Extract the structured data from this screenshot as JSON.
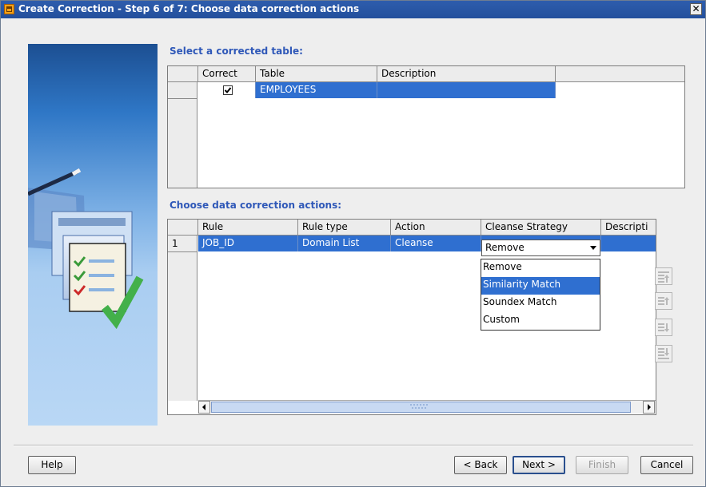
{
  "window": {
    "title": "Create Correction - Step 6 of 7: Choose data correction actions",
    "close_glyph": "✕"
  },
  "table1": {
    "label": "Select a corrected table:",
    "columns": [
      "Correct",
      "Table",
      "Description"
    ],
    "rows": [
      {
        "correct": true,
        "table": "EMPLOYEES",
        "description": ""
      }
    ]
  },
  "table2": {
    "label": "Choose data correction actions:",
    "columns": [
      "Rule",
      "Rule type",
      "Action",
      "Cleanse Strategy",
      "Descripti"
    ],
    "rows": [
      {
        "num": "1",
        "rule": "JOB_ID",
        "rule_type": "Domain List",
        "action": "Cleanse",
        "strategy": "Remove"
      }
    ],
    "dropdown_options": [
      "Remove",
      "Similarity Match",
      "Soundex Match",
      "Custom"
    ],
    "dropdown_highlighted": "Similarity Match"
  },
  "side_buttons": [
    {
      "icon": "move-to-top-icon"
    },
    {
      "icon": "move-up-icon"
    },
    {
      "icon": "move-down-icon"
    },
    {
      "icon": "move-to-bottom-icon"
    }
  ],
  "footer": {
    "help": "Help",
    "back": "< Back",
    "next": "Next >",
    "finish": "Finish",
    "cancel": "Cancel"
  },
  "colors": {
    "title_bar": "#2e5dad",
    "selection": "#2f6fd0",
    "section_label": "#2f58b8"
  }
}
